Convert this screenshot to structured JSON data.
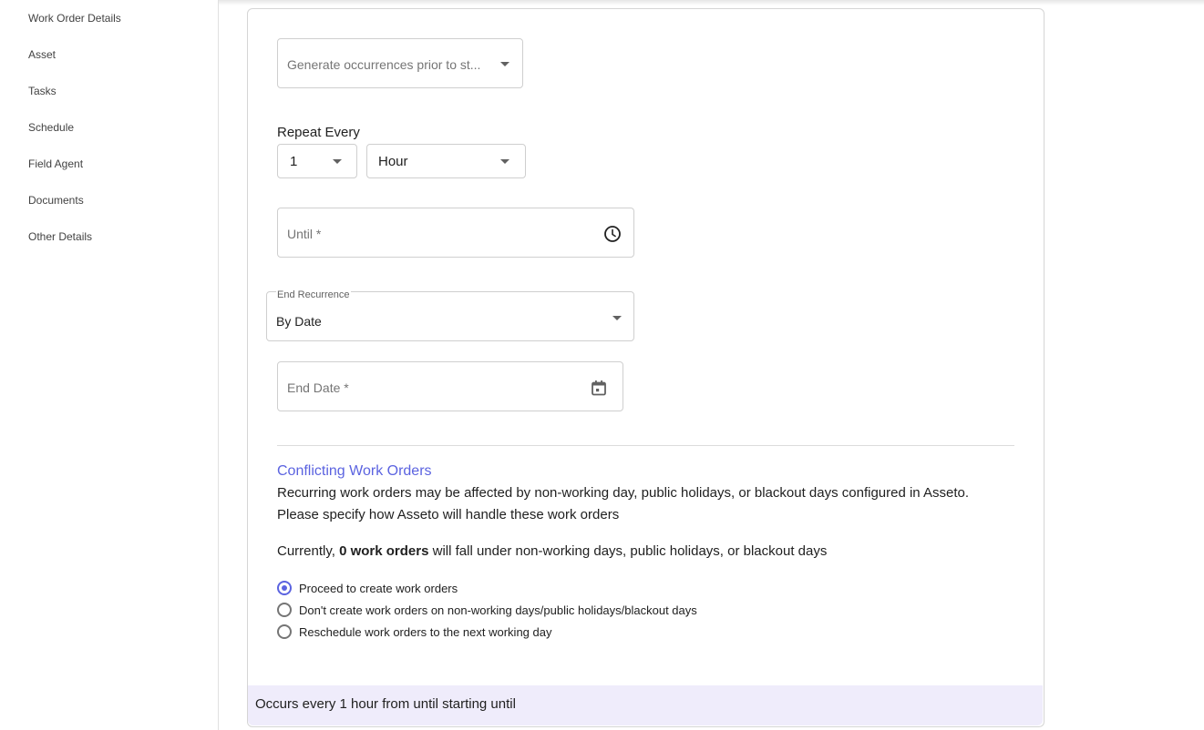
{
  "sidebar": {
    "items": [
      {
        "label": "Work Order Details"
      },
      {
        "label": "Asset"
      },
      {
        "label": "Tasks"
      },
      {
        "label": "Schedule"
      },
      {
        "label": "Field Agent"
      },
      {
        "label": "Documents"
      },
      {
        "label": "Other Details"
      }
    ]
  },
  "form": {
    "generate_prior": {
      "placeholder": "Generate occurrences prior to st..."
    },
    "repeat_every": {
      "label": "Repeat Every",
      "count": "1",
      "unit": "Hour"
    },
    "until": {
      "placeholder": "Until *",
      "icon": "clock-icon"
    },
    "end_recurrence": {
      "label": "End Recurrence",
      "value": "By Date"
    },
    "end_date": {
      "placeholder": "End Date *",
      "icon": "calendar-icon"
    }
  },
  "conflicts": {
    "title": "Conflicting Work Orders",
    "description_line1": "Recurring work orders may be affected by non-working day, public holidays, or blackout days configured in Asseto.",
    "description_line2": "Please specify how Asseto will handle these work orders",
    "currently_prefix": "Currently, ",
    "currently_count": "0 work orders",
    "currently_suffix": " will fall under non-working days, public holidays, or blackout days",
    "options": [
      {
        "label": "Proceed to create work orders",
        "selected": true
      },
      {
        "label": "Don't create work orders on non-working days/public holidays/blackout days",
        "selected": false
      },
      {
        "label": "Reschedule work orders to the next working day",
        "selected": false
      }
    ]
  },
  "summary": {
    "text": "Occurs every 1 hour from until starting until"
  },
  "colors": {
    "accent": "#5b63e0",
    "summary_bg": "#efecfb"
  }
}
